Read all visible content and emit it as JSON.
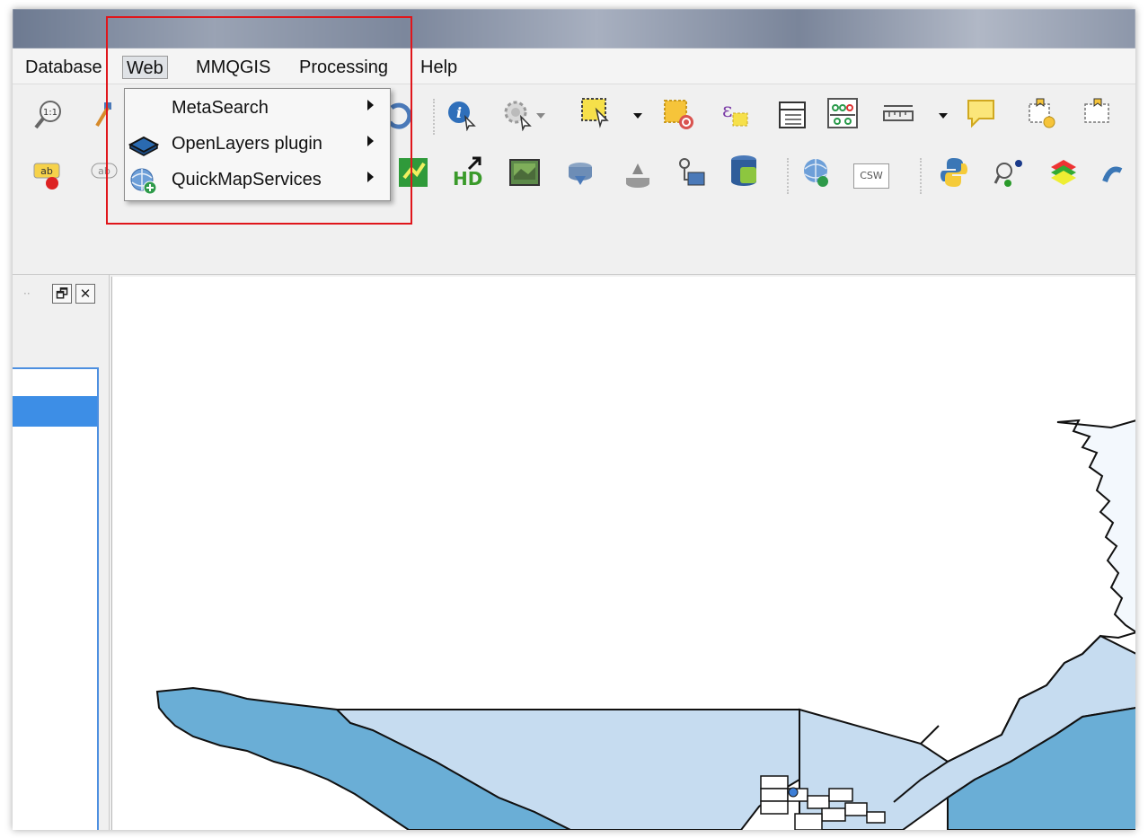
{
  "menubar": {
    "items": [
      "Database",
      "Web",
      "MMQGIS",
      "Processing",
      "Help"
    ],
    "active": "Web"
  },
  "web_menu": {
    "items": [
      {
        "label": "MetaSearch",
        "icon": "none",
        "has_submenu": true
      },
      {
        "label": "OpenLayers plugin",
        "icon": "openlayers-icon",
        "has_submenu": true
      },
      {
        "label": "QuickMapServices",
        "icon": "globe-add-icon",
        "has_submenu": true
      }
    ]
  },
  "toolbar": {
    "csw_label": "CSW"
  },
  "panel": {
    "float_symbol": "🗗",
    "close_symbol": "✕"
  },
  "colors": {
    "highlight": "#e0161b",
    "polygon_light": "#c6dcf0",
    "polygon_mid": "#6aaed6",
    "selection": "#3d8ee6"
  }
}
